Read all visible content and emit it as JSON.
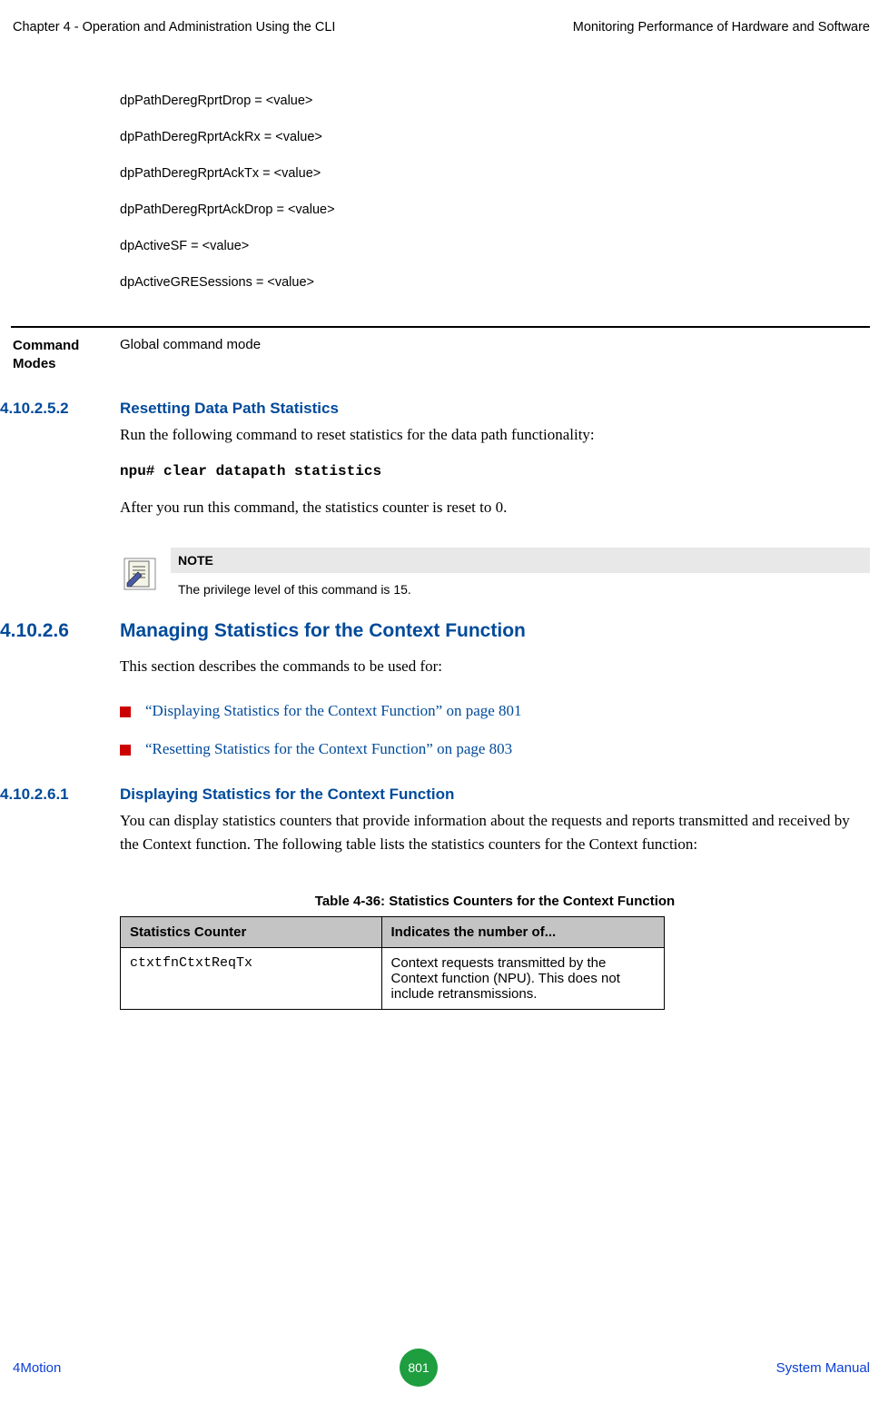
{
  "header": {
    "left": "Chapter 4 - Operation and Administration Using the CLI",
    "right": "Monitoring Performance of Hardware and Software"
  },
  "values": {
    "l1": "dpPathDeregRprtDrop = <value>",
    "l2": "dpPathDeregRprtAckRx = <value>",
    "l3": "dpPathDeregRprtAckTx = <value>",
    "l4": "dpPathDeregRprtAckDrop = <value>",
    "l5": "dpActiveSF = <value>",
    "l6": "dpActiveGRESessions = <value>"
  },
  "cmdmodes": {
    "label": "Command Modes",
    "value": "Global command mode"
  },
  "sec1": {
    "num": "4.10.2.5.2",
    "title": "Resetting Data Path Statistics",
    "para1": "Run the following command to reset statistics for the data path functionality:",
    "cmd": "npu# clear datapath statistics",
    "para2": "After you run this command, the statistics counter is reset to 0."
  },
  "note": {
    "head": "NOTE",
    "body": "The privilege level of this command is 15."
  },
  "sec2": {
    "num": "4.10.2.6",
    "title": "Managing Statistics for the Context Function",
    "para": "This section describes the commands to be used for:",
    "links": {
      "a": "“Displaying Statistics for the Context Function” on page 801",
      "b": "“Resetting Statistics for the Context Function” on page 803"
    }
  },
  "sec3": {
    "num": "4.10.2.6.1",
    "title": "Displaying Statistics for the Context Function",
    "para": "You can display statistics counters that provide information about the requests and reports transmitted and received by the Context function. The following table lists the statistics counters for the Context function:"
  },
  "table": {
    "caption": "Table 4-36: Statistics Counters for the Context Function",
    "h1": "Statistics Counter",
    "h2": "Indicates the number of...",
    "r1c1": "ctxtfnCtxtReqTx",
    "r1c2": "Context requests transmitted by the Context function (NPU). This does not include retransmissions."
  },
  "footer": {
    "left": "4Motion",
    "page": "801",
    "right": "System Manual"
  }
}
